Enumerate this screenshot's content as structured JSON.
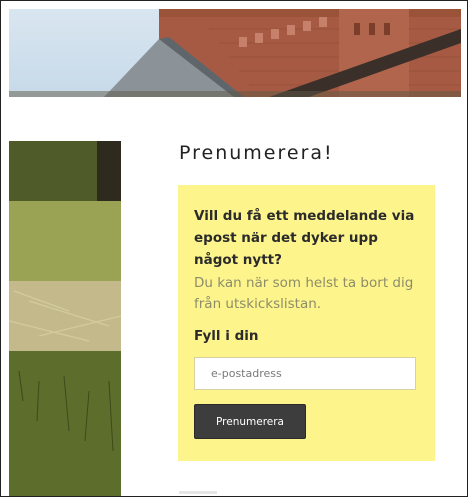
{
  "subscribe": {
    "title": "Prenumerera!",
    "heading": "Vill du få ett meddelande via epost när det dyker upp något nytt?",
    "subtext": "Du kan när som helst ta bort dig från utskickslistan.",
    "field_label": "Fyll i din",
    "email_placeholder": "e-postadress",
    "button_label": "Prenumerera"
  },
  "colors": {
    "card_background": "#fdf58c",
    "button_background": "#3d3d3d",
    "subtext": "#8c8c6a"
  }
}
